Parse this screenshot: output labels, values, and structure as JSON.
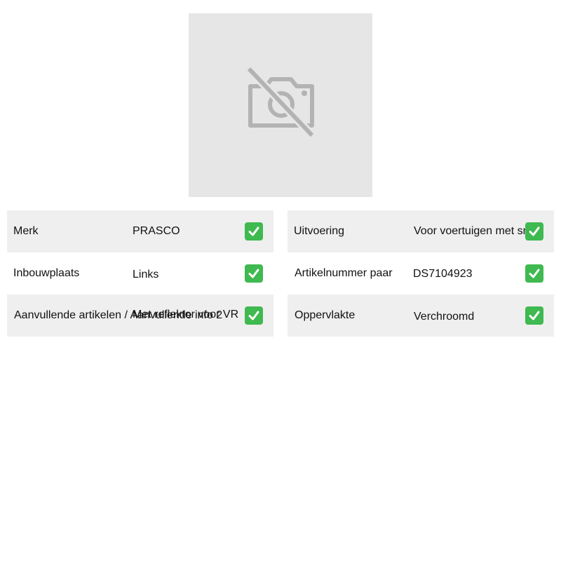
{
  "image": {
    "icon": "no-photo-camera-icon"
  },
  "specs_left": [
    {
      "label": "Merk",
      "value": "PRASCO",
      "checked": true
    },
    {
      "label": "Inbouwplaats",
      "value": "Links",
      "checked": true
    },
    {
      "label": "Aanvullende artikelen / Aanvullende info 2",
      "value": "Met reflektor voor VR",
      "checked": true
    }
  ],
  "specs_right": [
    {
      "label": "Uitvoering",
      "value": "Voor voertuigen met smth",
      "checked": true
    },
    {
      "label": "Artikelnummer paar",
      "value": "DS7104923",
      "checked": true
    },
    {
      "label": "Oppervlakte",
      "value": "Verchroomd",
      "checked": true
    }
  ],
  "colors": {
    "row_shade": "#efefef",
    "placeholder_bg": "#e6e6e6",
    "check_green": "#3fb950"
  }
}
